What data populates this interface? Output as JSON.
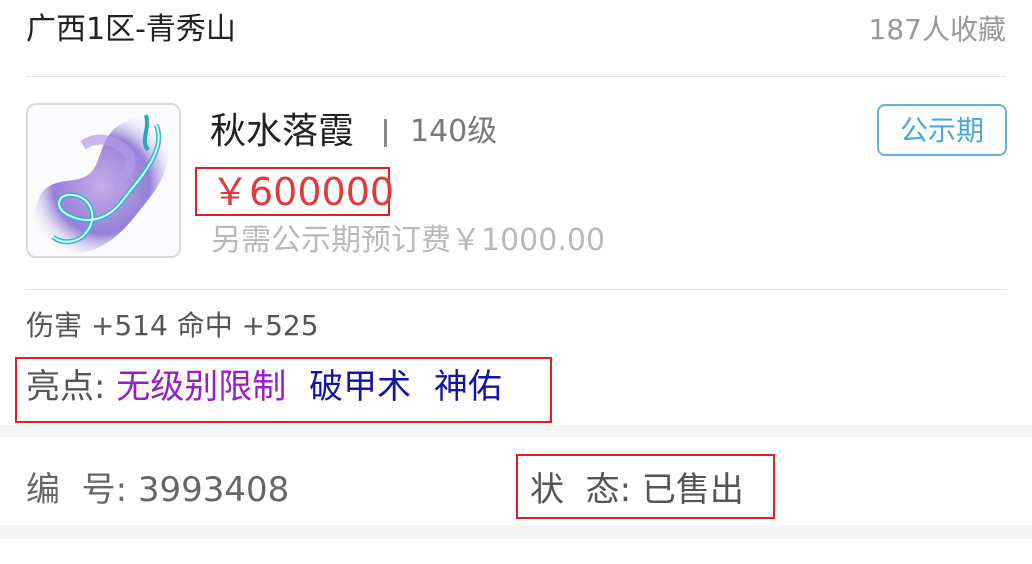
{
  "header": {
    "server": "广西1区-青秀山",
    "favorites": "187人收藏"
  },
  "item": {
    "name": "秋水落霞",
    "level": "140级",
    "status_badge": "公示期",
    "price": "￥600000",
    "extra_fee": "另需公示期预订费￥1000.00",
    "stats": "伤害 +514 命中 +525",
    "highlights_label": "亮点:",
    "highlights": [
      "无级别限制",
      "破甲术",
      "神佑"
    ],
    "icon": "ribbon-weapon-icon"
  },
  "info": {
    "serial_label": "编  号:",
    "serial_value": "3993408",
    "status_label": "状  态:",
    "status_value": "已售出"
  },
  "colors": {
    "price": "#e23a3a",
    "badge": "#4aa8e0",
    "highlight_purple": "#9a1cc4",
    "highlight_blue": "#1414a8",
    "annotation_box": "#e02020"
  }
}
